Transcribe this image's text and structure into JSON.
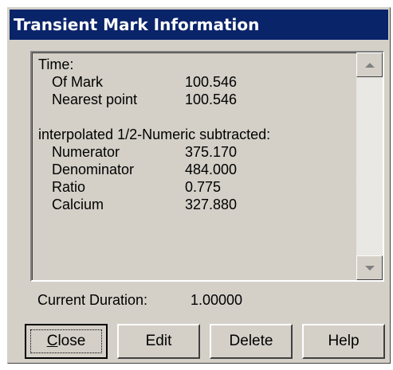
{
  "window": {
    "title": "Transient Mark Information"
  },
  "info": {
    "time_header": "Time:",
    "of_mark_label": "Of Mark",
    "of_mark_value": "100.546",
    "nearest_label": "Nearest point",
    "nearest_value": "100.546",
    "section_header": "interpolated 1/2-Numeric subtracted:",
    "numerator_label": "Numerator",
    "numerator_value": "375.170",
    "denominator_label": "Denominator",
    "denominator_value": "484.000",
    "ratio_label": "Ratio",
    "ratio_value": "0.775",
    "calcium_label": "Calcium",
    "calcium_value": "327.880"
  },
  "duration": {
    "label": "Current Duration:",
    "value": "1.00000"
  },
  "buttons": {
    "close_mnemonic": "C",
    "close_rest": "lose",
    "edit": "Edit",
    "delete": "Delete",
    "help": "Help"
  }
}
